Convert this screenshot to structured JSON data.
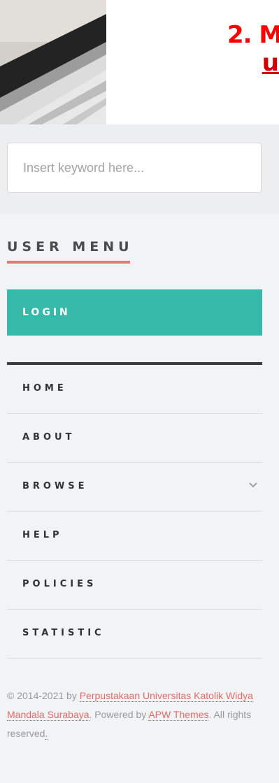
{
  "promo": {
    "title_fragment": "2. M",
    "link_fragment": "u"
  },
  "search": {
    "placeholder": "Insert keyword here..."
  },
  "user_menu": {
    "heading": "USER MENU",
    "login_label": "LOGIN"
  },
  "nav": {
    "items": [
      {
        "label": "HOME"
      },
      {
        "label": "ABOUT"
      },
      {
        "label": "BROWSE",
        "icon": "chevron-down-icon"
      },
      {
        "label": "HELP"
      },
      {
        "label": "POLICIES"
      },
      {
        "label": "STATISTIC"
      }
    ]
  },
  "footer": {
    "copyright_prefix": "© 2014-2021 by",
    "org_link": "Perpustakaan Universitas Katolik Widya Mandala Surabaya",
    "powered_by": ". Powered by",
    "theme_link": "APW Themes",
    "rights": ". All rights reserved",
    "trailing_link": "."
  },
  "colors": {
    "accent_teal": "#36b9a8",
    "accent_red": "#ff0000",
    "underline_pink": "#e07a7a",
    "link_pink": "#e06b6b"
  }
}
